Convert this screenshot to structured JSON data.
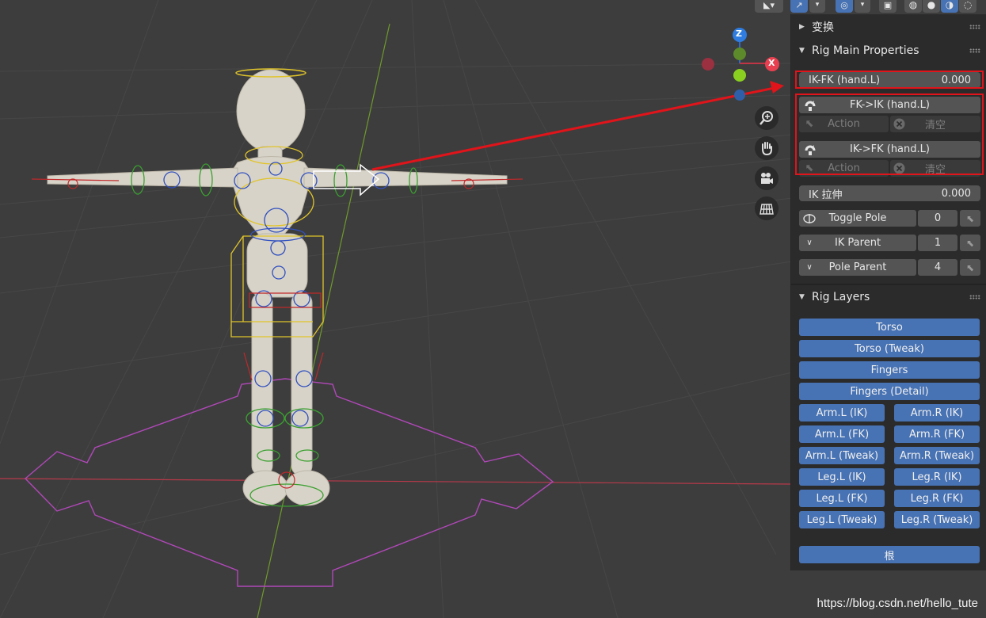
{
  "sidebar": {
    "transform_header": "变换",
    "rig_main_header": "Rig Main Properties",
    "rig_layers_header": "Rig Layers",
    "ikfk": {
      "label": "IK-FK (hand.L)",
      "value": "0.000"
    },
    "snap1": {
      "label": "FK->IK (hand.L)",
      "action": "Action",
      "clear": "清空"
    },
    "snap2": {
      "label": "IK->FK (hand.L)",
      "action": "Action",
      "clear": "清空"
    },
    "ik_stretch": {
      "label": "IK 拉伸",
      "value": "0.000"
    },
    "toggle_pole": {
      "label": "Toggle Pole",
      "value": "0"
    },
    "ik_parent": {
      "label": "IK Parent",
      "value": "1"
    },
    "pole_parent": {
      "label": "Pole Parent",
      "value": "4"
    },
    "layers": {
      "torso": "Torso",
      "torso_tweak": "Torso (Tweak)",
      "fingers": "Fingers",
      "fingers_detail": "Fingers (Detail)",
      "arm_l_ik": "Arm.L (IK)",
      "arm_r_ik": "Arm.R (IK)",
      "arm_l_fk": "Arm.L (FK)",
      "arm_r_fk": "Arm.R (FK)",
      "arm_l_tweak": "Arm.L (Tweak)",
      "arm_r_tweak": "Arm.R (Tweak)",
      "leg_l_ik": "Leg.L (IK)",
      "leg_r_ik": "Leg.R (IK)",
      "leg_l_fk": "Leg.L (FK)",
      "leg_r_fk": "Leg.R (FK)",
      "leg_l_tweak": "Leg.L (Tweak)",
      "leg_r_tweak": "Leg.R (Tweak)",
      "root": "根"
    }
  },
  "gizmo": {
    "z": "Z",
    "x": "X"
  },
  "watermark": "https://blog.csdn.net/hello_tute",
  "colors": {
    "viewport_bg": "#3d3d3d",
    "panel_bg": "#2b2b2b",
    "layer_button": "#4772b3",
    "highlight_box": "#e0141a",
    "axis_x": "#c03545",
    "axis_y": "#6f9a2a",
    "armature_yellow": "#e0c42a"
  }
}
